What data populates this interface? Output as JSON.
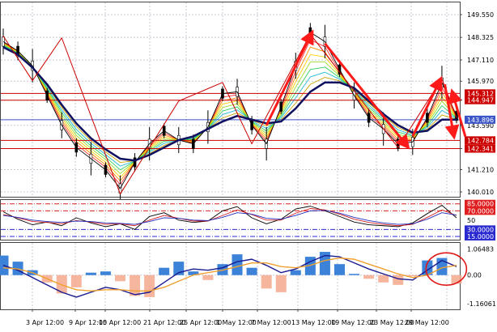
{
  "chart_data": [
    {
      "type": "line",
      "panel": "price",
      "x_labels": [
        "3 Apr 12:00",
        "9 Apr 12:00",
        "15 Apr 12:00",
        "21 Apr 12:00",
        "25 Apr 12:00",
        "1 May 12:00",
        "7 May 12:00",
        "13 May 12:00",
        "19 May 12:00",
        "23 May 12:00",
        "29 May 12:00"
      ],
      "y_ticks": [
        140.01,
        141.21,
        142.341,
        143.59,
        144.947,
        145.97,
        147.11,
        148.325,
        149.55
      ],
      "ylim": [
        139.75,
        150.25
      ],
      "grid": true,
      "price_series": [
        148.1,
        147.6,
        146.8,
        145.2,
        143.6,
        142.4,
        141.8,
        141.2,
        140.2,
        141.6,
        142.6,
        143.3,
        142.8,
        142.6,
        143.5,
        145.3,
        145.4,
        143.6,
        142.6,
        144.6,
        146.8,
        148.6,
        148.1,
        146.6,
        145.2,
        144.0,
        143.4,
        142.6,
        142.7,
        144.0,
        145.9,
        144.1
      ],
      "moving_average": [
        147.8,
        147.4,
        146.7,
        145.8,
        144.7,
        143.7,
        142.9,
        142.3,
        141.8,
        141.7,
        142.0,
        142.4,
        142.8,
        143.0,
        143.4,
        143.8,
        144.1,
        143.9,
        143.7,
        143.8,
        144.5,
        145.4,
        145.9,
        145.9,
        145.6,
        144.9,
        144.2,
        143.6,
        143.2,
        143.3,
        143.9,
        143.9
      ],
      "horizontal_levels": [
        {
          "label": "145.312",
          "value": 145.312,
          "color": "#cc0000"
        },
        {
          "label": "144.947",
          "value": 144.947,
          "color": "#cc0000"
        },
        {
          "label": "143.896",
          "value": 143.896,
          "color": "#3a55c8"
        },
        {
          "label": "142.784",
          "value": 142.784,
          "color": "#cc0000"
        },
        {
          "label": "142.341",
          "value": 142.341,
          "color": "#cc0000"
        }
      ],
      "zigzag": [
        [
          0,
          148.4
        ],
        [
          2,
          146.0
        ],
        [
          4,
          148.3
        ],
        [
          8,
          139.9
        ],
        [
          12,
          144.9
        ],
        [
          15,
          145.9
        ],
        [
          17,
          142.6
        ],
        [
          21,
          148.5
        ],
        [
          27,
          142.4
        ],
        [
          30,
          146.1
        ],
        [
          31,
          144.0
        ]
      ],
      "arrows": [
        {
          "from": [
            18,
            143.6
          ],
          "to": [
            21,
            148.4
          ]
        },
        {
          "from": [
            22,
            148.0
          ],
          "to": [
            27.5,
            142.6
          ]
        },
        {
          "from": [
            28,
            143.0
          ],
          "to": [
            29.8,
            145.9
          ]
        },
        {
          "from": [
            30.2,
            145.8
          ],
          "to": [
            31.4,
            143.2
          ]
        },
        {
          "from": [
            31.6,
            143.0
          ],
          "to": [
            32.6,
            145.2
          ]
        }
      ],
      "colors": {
        "price": "#000000",
        "ma": "#101060",
        "zigzag": "#cc0000",
        "arrow": "#ff1a1a",
        "grid": "#c8c8d4"
      }
    },
    {
      "type": "line",
      "panel": "oscillator",
      "y_ticks": [
        85.0,
        70.0,
        50,
        30.0,
        15.0
      ],
      "tick_labels": [
        "85.0000",
        "70.0000",
        "50",
        "30.0000",
        "15.0000"
      ],
      "ylim": [
        8,
        95
      ],
      "levels": [
        {
          "label": "85.0000",
          "value": 85,
          "color": "#e02020",
          "badge": true
        },
        {
          "label": "70.0000",
          "value": 70,
          "color": "#e02020",
          "badge": true
        },
        {
          "label": "30.0000",
          "value": 30,
          "color": "#2a2ad0",
          "badge": true
        },
        {
          "label": "15.0000",
          "value": 15,
          "color": "#2a2ad0",
          "badge": true
        }
      ],
      "series": [
        {
          "values": [
            68,
            52,
            40,
            46,
            38,
            55,
            44,
            36,
            42,
            30,
            58,
            66,
            50,
            45,
            48,
            70,
            79,
            55,
            42,
            52,
            74,
            80,
            70,
            58,
            46,
            40,
            38,
            36,
            44,
            64,
            82,
            55
          ],
          "color": "#000000"
        },
        {
          "values": [
            62,
            55,
            47,
            45,
            42,
            49,
            46,
            41,
            42,
            38,
            50,
            60,
            54,
            48,
            48,
            60,
            72,
            62,
            50,
            50,
            65,
            75,
            72,
            63,
            52,
            45,
            41,
            38,
            41,
            56,
            72,
            60
          ],
          "color": "#d02020"
        },
        {
          "values": [
            60,
            56,
            50,
            47,
            45,
            48,
            47,
            44,
            43,
            41,
            47,
            55,
            54,
            50,
            49,
            56,
            66,
            63,
            54,
            52,
            60,
            70,
            71,
            65,
            56,
            49,
            44,
            41,
            42,
            52,
            66,
            61
          ],
          "color": "#2030c0"
        }
      ]
    },
    {
      "type": "bar",
      "panel": "macd",
      "y_ticks": [
        1.06483,
        0.0,
        -1.16061
      ],
      "tick_labels": [
        "1.06483",
        "0.00",
        "-1.16061"
      ],
      "ylim": [
        -1.4,
        1.35
      ],
      "histogram": [
        0.8,
        0.55,
        0.2,
        -0.3,
        -0.75,
        -0.5,
        0.1,
        0.15,
        -0.25,
        -0.85,
        -0.9,
        0.3,
        0.55,
        0.15,
        -0.2,
        0.45,
        0.85,
        0.3,
        -0.55,
        -0.7,
        0.2,
        0.75,
        0.95,
        0.45,
        0.05,
        -0.15,
        -0.3,
        -0.4,
        -0.05,
        0.6,
        0.7,
        -0.35
      ],
      "positive_color": "#3b82d8",
      "negative_color": "#f4a88c",
      "series": [
        {
          "values": [
            0.4,
            0.2,
            -0.1,
            -0.4,
            -0.7,
            -0.9,
            -0.7,
            -0.5,
            -0.6,
            -0.8,
            -0.7,
            -0.3,
            0.1,
            0.25,
            0.2,
            0.3,
            0.55,
            0.65,
            0.4,
            0.1,
            0.25,
            0.55,
            0.8,
            0.75,
            0.5,
            0.25,
            0.05,
            -0.15,
            -0.2,
            0.2,
            0.6,
            0.35
          ],
          "color": "#1a1a90"
        },
        {
          "values": [
            0.3,
            0.25,
            0.1,
            -0.15,
            -0.4,
            -0.6,
            -0.65,
            -0.6,
            -0.6,
            -0.65,
            -0.65,
            -0.5,
            -0.25,
            0.0,
            0.1,
            0.2,
            0.35,
            0.5,
            0.5,
            0.35,
            0.3,
            0.4,
            0.6,
            0.7,
            0.65,
            0.45,
            0.25,
            0.05,
            -0.1,
            0.0,
            0.3,
            0.4
          ],
          "color": "#f0a030"
        }
      ],
      "highlight_ellipse": true
    }
  ]
}
